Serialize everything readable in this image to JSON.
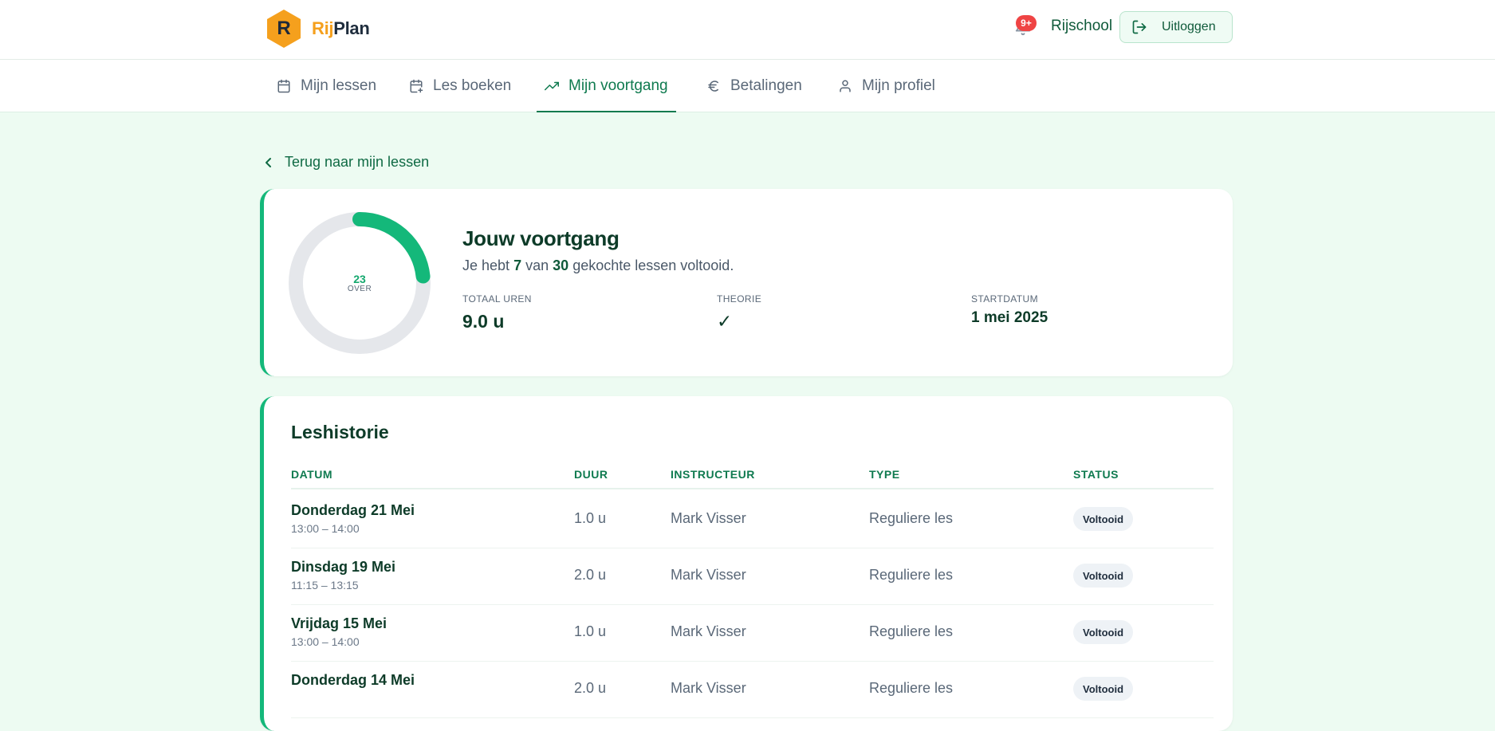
{
  "brand": {
    "logo_letter": "R",
    "name_part1": "Rij",
    "name_part2": "Plan"
  },
  "header": {
    "notification_badge": "9+",
    "school_name": "Rijschool",
    "logout_label": "Uitloggen"
  },
  "nav": {
    "items": [
      {
        "label": "Mijn lessen",
        "icon": "calendar-icon"
      },
      {
        "label": "Les boeken",
        "icon": "calendar-plus-icon"
      },
      {
        "label": "Mijn voortgang",
        "icon": "trending-up-icon",
        "active": true
      },
      {
        "label": "Betalingen",
        "icon": "euro-icon"
      },
      {
        "label": "Mijn profiel",
        "icon": "user-icon"
      }
    ]
  },
  "back_link": "Terug naar mijn lessen",
  "progress": {
    "title": "Jouw voortgang",
    "sub_prefix": "Je hebt",
    "completed": "7",
    "sub_mid": "van",
    "total": "30",
    "sub_suffix": "gekochte lessen voltooid.",
    "ring_remaining": "23",
    "ring_label": "OVER",
    "ring_fraction": 0.233,
    "stats": [
      {
        "label": "TOTAAL UREN",
        "value": "9.0 u"
      },
      {
        "label": "THEORIE",
        "value": "✓"
      },
      {
        "label": "STARTDATUM",
        "value": "1 mei 2025"
      }
    ],
    "colors": {
      "accent": "#14b87a",
      "track": "#e5e7eb"
    }
  },
  "history": {
    "title": "Leshistorie",
    "columns": [
      "DATUM",
      "DUUR",
      "INSTRUCTEUR",
      "TYPE",
      "STATUS"
    ],
    "rows": [
      {
        "date": "Donderdag 21 Mei",
        "time": "13:00 – 14:00",
        "duration": "1.0 u",
        "instructor": "Mark Visser",
        "type": "Reguliere les",
        "status": "Voltooid"
      },
      {
        "date": "Dinsdag 19 Mei",
        "time": "11:15 – 13:15",
        "duration": "2.0 u",
        "instructor": "Mark Visser",
        "type": "Reguliere les",
        "status": "Voltooid"
      },
      {
        "date": "Vrijdag 15 Mei",
        "time": "13:00 – 14:00",
        "duration": "1.0 u",
        "instructor": "Mark Visser",
        "type": "Reguliere les",
        "status": "Voltooid"
      },
      {
        "date": "Donderdag 14 Mei",
        "time": "",
        "duration": "2.0 u",
        "instructor": "Mark Visser",
        "type": "Reguliere les",
        "status": "Voltooid"
      }
    ]
  }
}
